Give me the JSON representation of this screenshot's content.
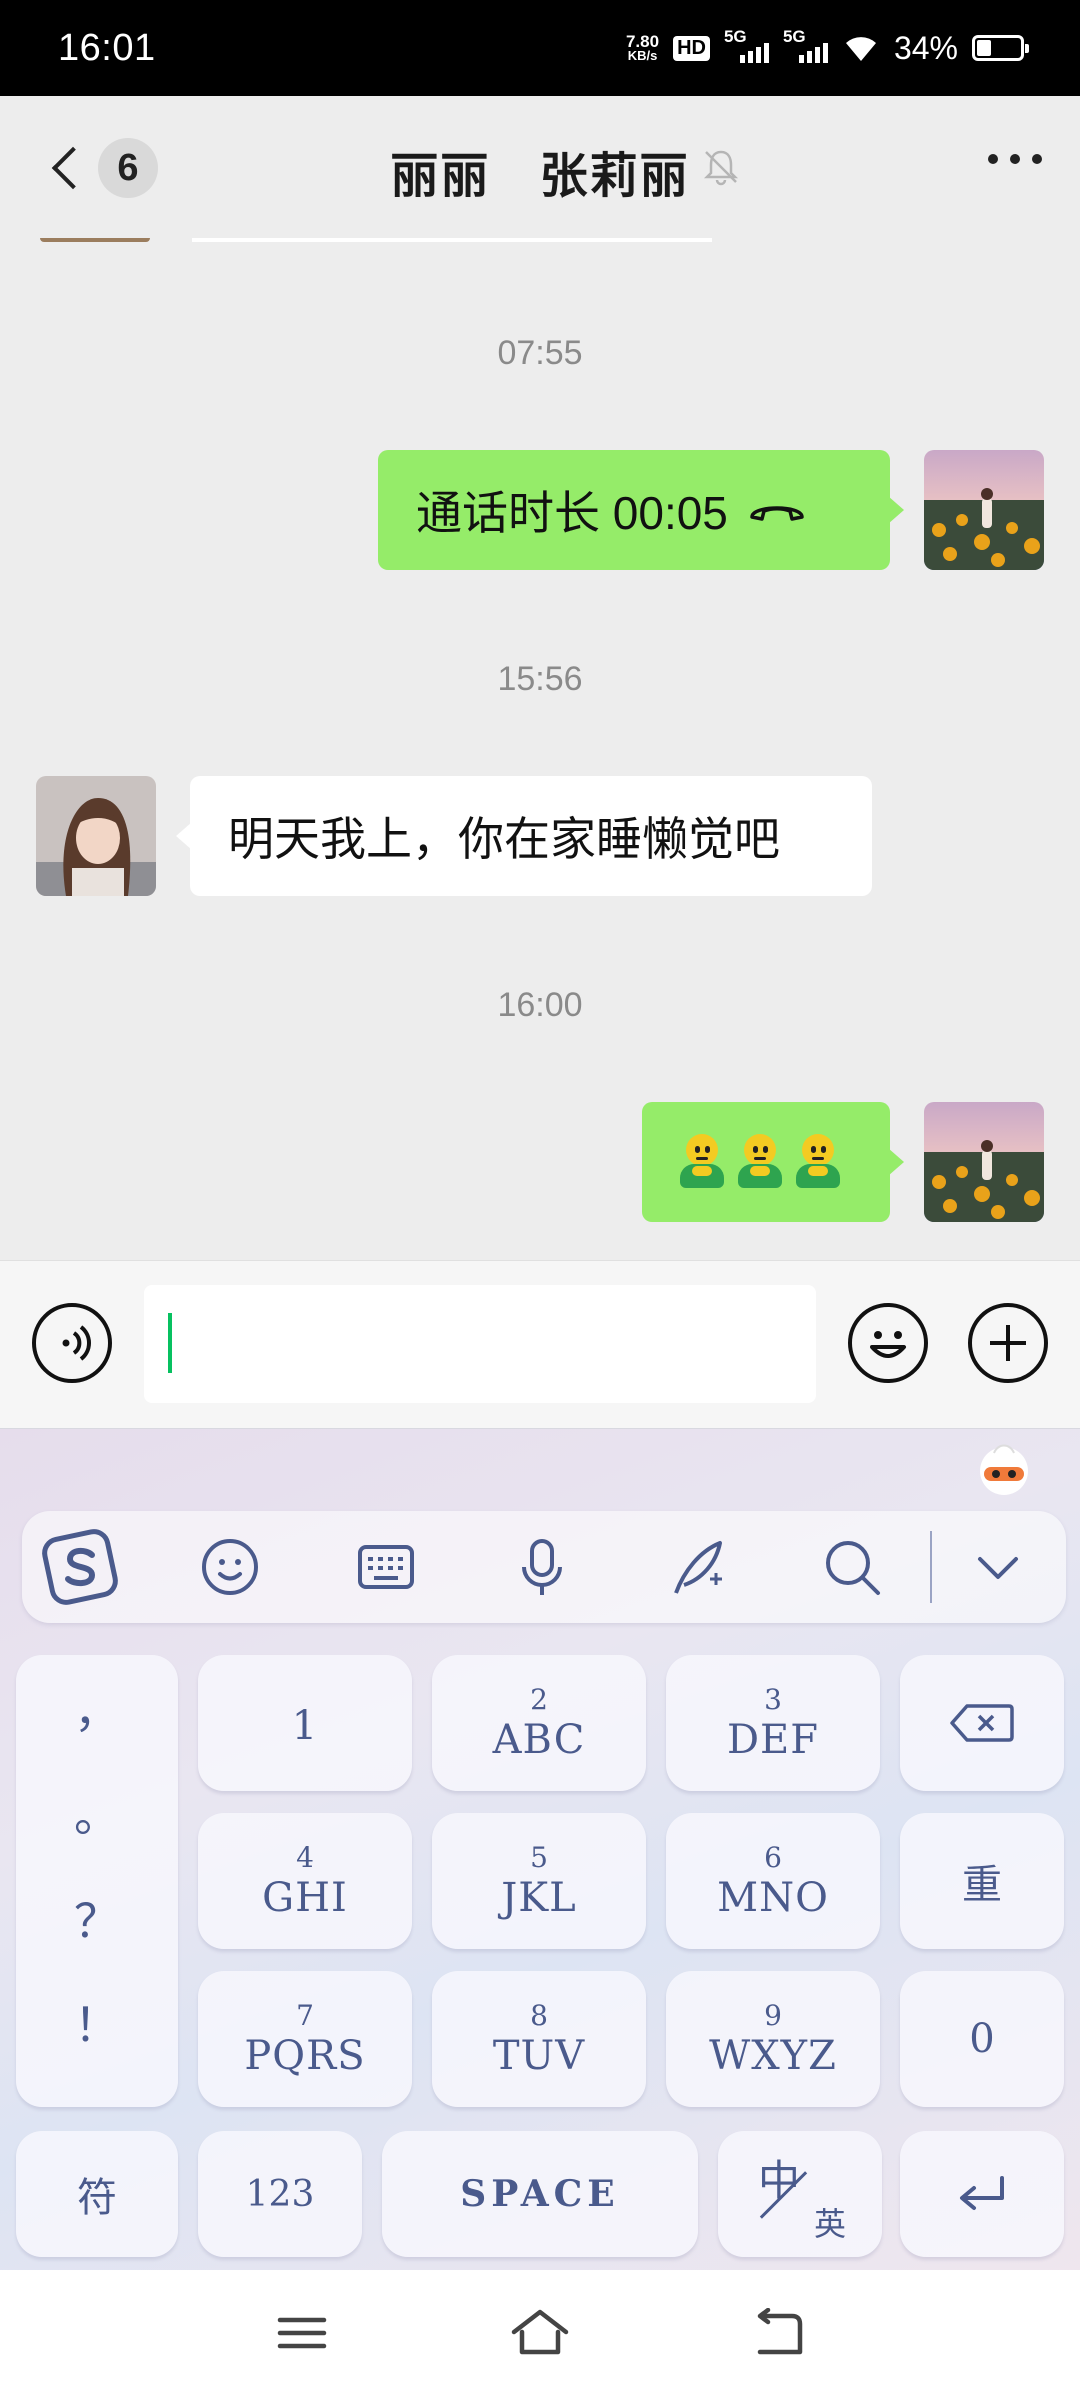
{
  "status_bar": {
    "time": "16:01",
    "net_speed_value": "7.80",
    "net_speed_unit": "KB/s",
    "hd_label": "HD",
    "sim1_label": "5G",
    "sim2_label": "5G",
    "battery_percent": "34%",
    "battery_level": 0.34
  },
  "header": {
    "unread_count": "6",
    "title": "丽丽  张莉丽"
  },
  "messages": [
    {
      "type": "timestamp",
      "text": "07:55"
    },
    {
      "type": "outgoing",
      "text": "通话时长 00:05"
    },
    {
      "type": "timestamp",
      "text": "15:56"
    },
    {
      "type": "incoming",
      "text": "明天我上，你在家睡懒觉吧"
    },
    {
      "type": "timestamp",
      "text": "16:00"
    },
    {
      "type": "outgoing",
      "emoji_count": 3,
      "emoji_name": "green-shirt-emoji"
    }
  ],
  "input": {
    "value": "",
    "placeholder": ""
  },
  "keyboard": {
    "punctuation": [
      "，",
      "。",
      "？",
      "！"
    ],
    "keys": [
      {
        "num": "",
        "letters": "1"
      },
      {
        "num": "2",
        "letters": "ABC"
      },
      {
        "num": "3",
        "letters": "DEF"
      },
      {
        "num": "4",
        "letters": "GHI"
      },
      {
        "num": "5",
        "letters": "JKL"
      },
      {
        "num": "6",
        "letters": "MNO"
      },
      {
        "num": "7",
        "letters": "PQRS"
      },
      {
        "num": "8",
        "letters": "TUV"
      },
      {
        "num": "9",
        "letters": "WXYZ"
      }
    ],
    "reset_label": "重",
    "zero_label": "0",
    "symbols_label": "符",
    "numbers_label": "123",
    "space_label": "SPACE",
    "lang_cn": "中",
    "lang_en": "英"
  },
  "colors": {
    "bubble_outgoing": "#95ec69",
    "bubble_incoming": "#ffffff",
    "caret": "#07c160",
    "key_text": "#4a5a8c"
  }
}
